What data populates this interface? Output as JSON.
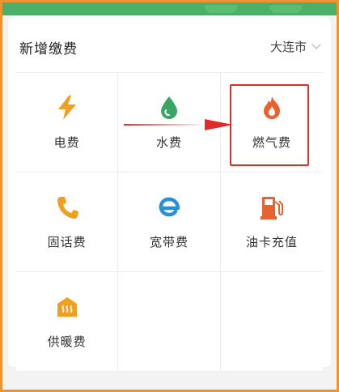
{
  "header": {
    "title": "新增缴费",
    "city": "大连市"
  },
  "grid": {
    "items": [
      {
        "label": "电费",
        "icon": "lightning-icon",
        "color": "#f0a020"
      },
      {
        "label": "水费",
        "icon": "water-drop-icon",
        "color": "#3aa565"
      },
      {
        "label": "燃气费",
        "icon": "flame-icon",
        "color": "#e8622f"
      },
      {
        "label": "固话费",
        "icon": "phone-icon",
        "color": "#f0a020"
      },
      {
        "label": "宽带费",
        "icon": "broadband-e-icon",
        "color": "#2b8fd6"
      },
      {
        "label": "油卡充值",
        "icon": "fuel-pump-icon",
        "color": "#e8622f"
      },
      {
        "label": "供暖费",
        "icon": "heating-icon",
        "color": "#f0a020"
      }
    ]
  },
  "colors": {
    "frame": "#f0932f",
    "highlight": "#e02b2b",
    "band": "#4caf6a"
  }
}
